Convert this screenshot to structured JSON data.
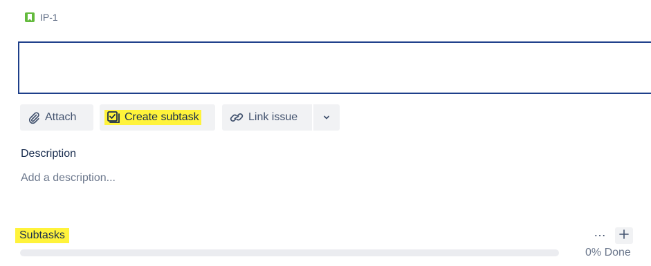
{
  "issue": {
    "key": "IP-1",
    "icon": "story-icon"
  },
  "summary": {
    "value": ""
  },
  "toolbar": {
    "attach_label": "Attach",
    "create_subtask_label": "Create subtask",
    "link_issue_label": "Link issue",
    "more_icon": "chevron-down-icon"
  },
  "description": {
    "label": "Description",
    "placeholder": "Add a description..."
  },
  "subtasks": {
    "label": "Subtasks",
    "more_label": "…",
    "progress_percent": 0,
    "progress_text": "0% Done"
  },
  "colors": {
    "focus_border": "#1e3f8a",
    "highlight": "#fff33b",
    "story_icon": "#63ba3c",
    "button_bg": "#f1f2f4"
  }
}
